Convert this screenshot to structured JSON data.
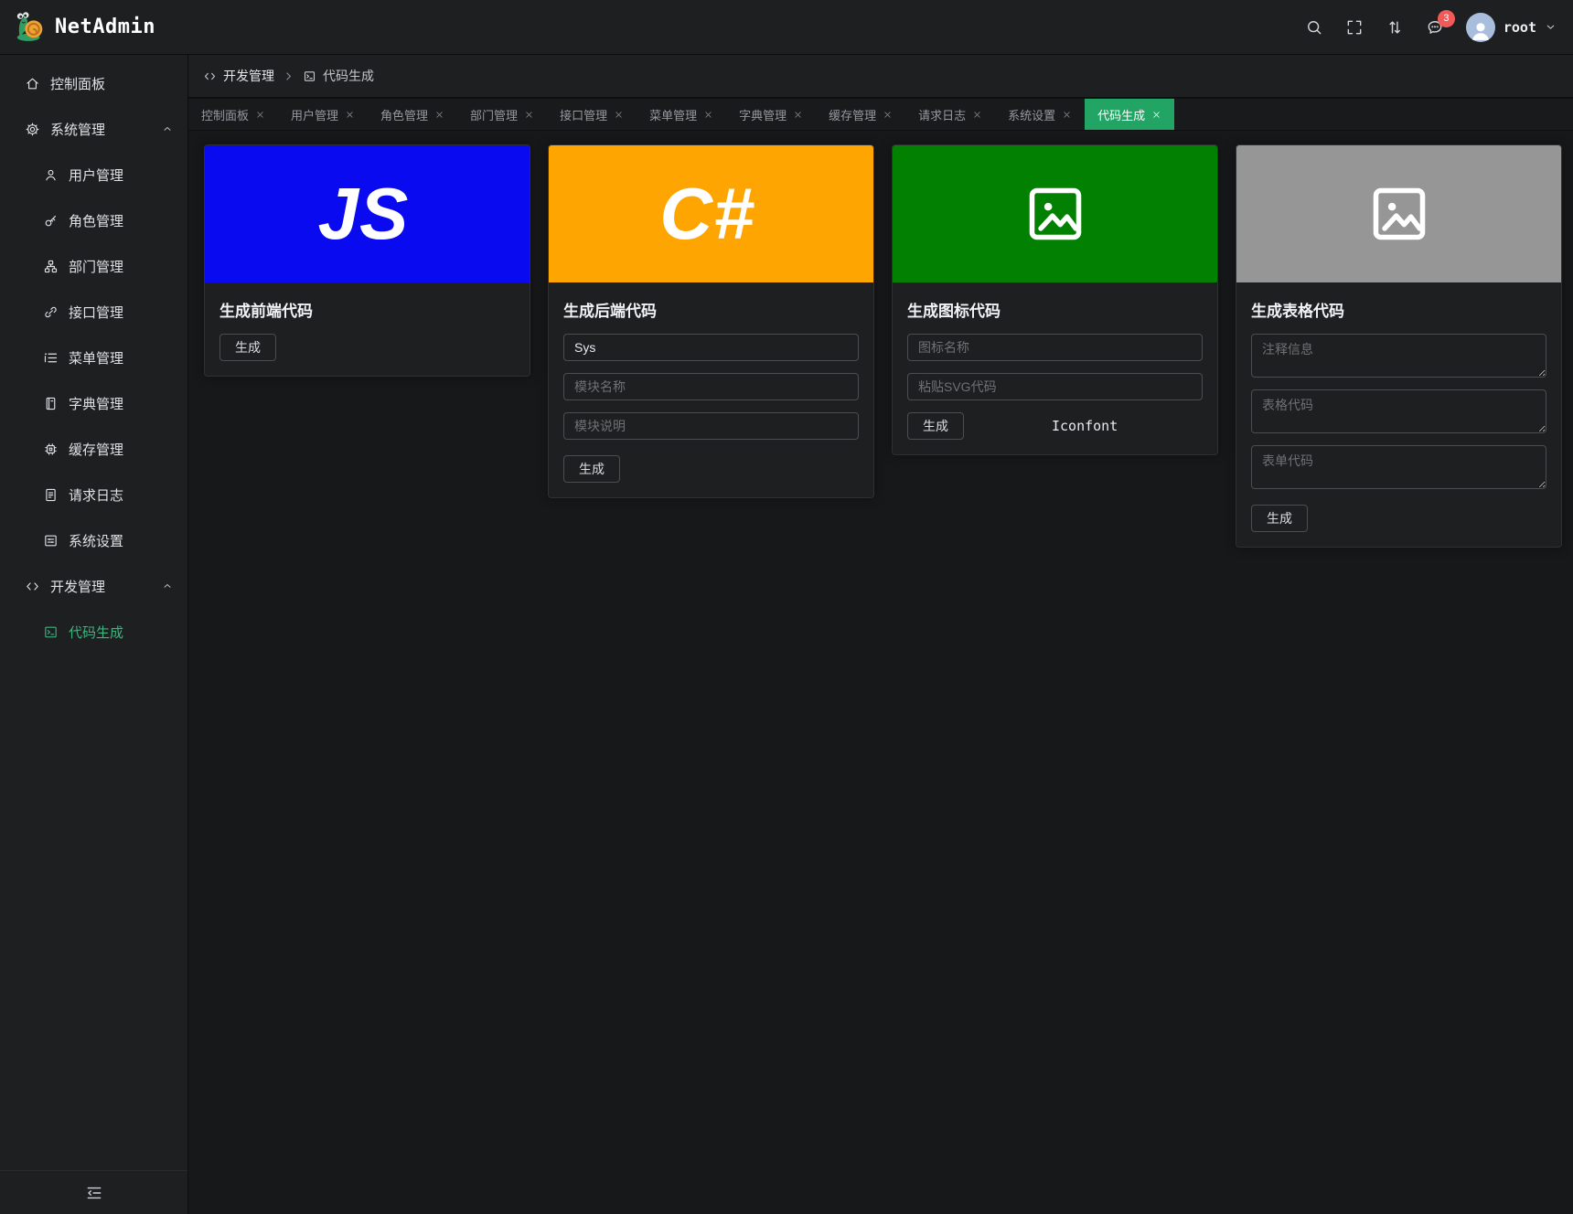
{
  "app": {
    "name": "NetAdmin"
  },
  "header": {
    "username": "root",
    "message_badge": "3",
    "icons": [
      "search-icon",
      "fullscreen-icon",
      "switch-icon",
      "message-icon",
      "avatar",
      "chevron-down-icon"
    ]
  },
  "sidebar": {
    "active_color": "#3eb47e",
    "items": [
      {
        "label": "控制面板",
        "icon": "home-icon"
      },
      {
        "label": "系统管理",
        "icon": "gear-icon"
      },
      {
        "label": "用户管理",
        "icon": "user-icon"
      },
      {
        "label": "角色管理",
        "icon": "key-icon"
      },
      {
        "label": "部门管理",
        "icon": "org-icon"
      },
      {
        "label": "接口管理",
        "icon": "link-icon"
      },
      {
        "label": "菜单管理",
        "icon": "menu-list-icon"
      },
      {
        "label": "字典管理",
        "icon": "book-icon"
      },
      {
        "label": "缓存管理",
        "icon": "cpu-icon"
      },
      {
        "label": "请求日志",
        "icon": "document-icon"
      },
      {
        "label": "系统设置",
        "icon": "settings-panel-icon"
      },
      {
        "label": "开发管理",
        "icon": "code-icon"
      },
      {
        "label": "代码生成",
        "icon": "terminal-icon"
      }
    ]
  },
  "breadcrumb": {
    "parent": "开发管理",
    "current": "代码生成"
  },
  "tabs": {
    "active_bg": "#22a464",
    "items": [
      {
        "label": "控制面板"
      },
      {
        "label": "用户管理"
      },
      {
        "label": "角色管理"
      },
      {
        "label": "部门管理"
      },
      {
        "label": "接口管理"
      },
      {
        "label": "菜单管理"
      },
      {
        "label": "字典管理"
      },
      {
        "label": "缓存管理"
      },
      {
        "label": "请求日志"
      },
      {
        "label": "系统设置"
      },
      {
        "label": "代码生成"
      }
    ]
  },
  "cards": {
    "frontend": {
      "title": "生成前端代码",
      "banner_text": "JS",
      "banner_color": "#0a0af0",
      "generate_label": "生成"
    },
    "backend": {
      "title": "生成后端代码",
      "banner_text": "C#",
      "banner_color": "#ffa502",
      "module_prefix_value": "Sys",
      "module_name_placeholder": "模块名称",
      "module_desc_placeholder": "模块说明",
      "generate_label": "生成"
    },
    "icon": {
      "title": "生成图标代码",
      "banner_color": "#028002",
      "icon_name_placeholder": "图标名称",
      "svg_placeholder": "粘贴SVG代码",
      "generate_label": "生成",
      "link_label": "Iconfont"
    },
    "table": {
      "title": "生成表格代码",
      "banner_color": "#969696",
      "comment_placeholder": "注释信息",
      "table_placeholder": "表格代码",
      "form_placeholder": "表单代码",
      "generate_label": "生成"
    }
  }
}
